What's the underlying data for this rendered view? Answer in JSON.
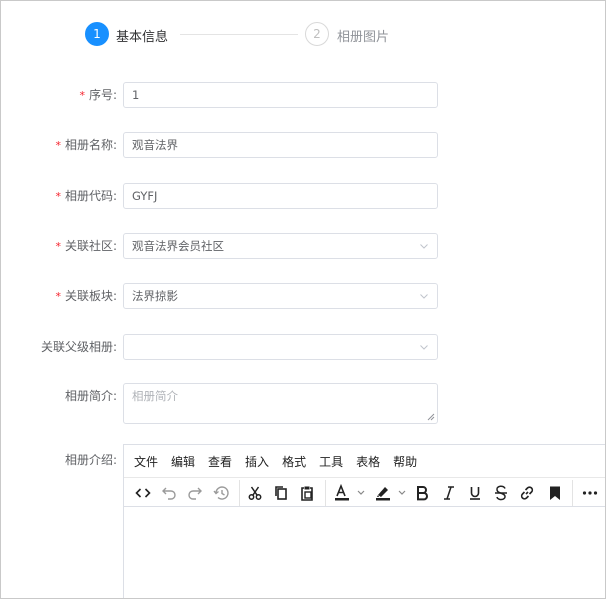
{
  "steps": [
    {
      "number": "1",
      "title": "基本信息",
      "status": "active"
    },
    {
      "number": "2",
      "title": "相册图片",
      "status": "inactive"
    }
  ],
  "form": {
    "order": {
      "label": "序号:",
      "value": "1"
    },
    "name": {
      "label": "相册名称:",
      "value": "观音法界"
    },
    "code": {
      "label": "相册代码:",
      "value": "GYFJ"
    },
    "community": {
      "label": "关联社区:",
      "value": "观音法界会员社区"
    },
    "board": {
      "label": "关联板块:",
      "value": "法界掠影"
    },
    "parent": {
      "label": "关联父级相册:",
      "value": ""
    },
    "brief": {
      "label": "相册简介:",
      "placeholder": "相册简介"
    },
    "intro": {
      "label": "相册介绍:"
    },
    "required_mark": "*"
  },
  "editor": {
    "menus": [
      "文件",
      "编辑",
      "查看",
      "插入",
      "格式",
      "工具",
      "表格",
      "帮助"
    ],
    "toolbar_icons": [
      "source-code-icon",
      "undo-icon",
      "redo-icon",
      "restore-draft-icon",
      "cut-icon",
      "copy-icon",
      "paste-icon",
      "text-color-icon",
      "highlight-color-icon",
      "bold-icon",
      "italic-icon",
      "underline-icon",
      "strikethrough-icon",
      "link-icon",
      "bookmark-icon",
      "more-icon"
    ]
  },
  "colors": {
    "accent": "#1890ff",
    "required": "#f5222d",
    "border": "#dcdfe6"
  }
}
